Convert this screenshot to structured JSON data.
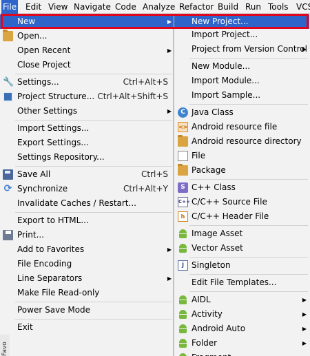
{
  "menubar": {
    "items": [
      "File",
      "Edit",
      "View",
      "Navigate",
      "Code",
      "Analyze",
      "Refactor",
      "Build",
      "Run",
      "Tools",
      "VCS"
    ],
    "active_item": "File"
  },
  "file_menu": {
    "new": "New",
    "open": "Open...",
    "open_recent": "Open Recent",
    "close_project": "Close Project",
    "settings": "Settings...",
    "settings_shortcut": "Ctrl+Alt+S",
    "project_structure": "Project Structure...",
    "project_structure_shortcut": "Ctrl+Alt+Shift+S",
    "other_settings": "Other Settings",
    "import_settings": "Import Settings...",
    "export_settings": "Export Settings...",
    "settings_repository": "Settings Repository...",
    "save_all": "Save All",
    "save_all_shortcut": "Ctrl+S",
    "synchronize": "Synchronize",
    "synchronize_shortcut": "Ctrl+Alt+Y",
    "invalidate_caches": "Invalidate Caches / Restart...",
    "export_html": "Export to HTML...",
    "print": "Print...",
    "add_to_favorites": "Add to Favorites",
    "file_encoding": "File Encoding",
    "line_separators": "Line Separators",
    "make_read_only": "Make File Read-only",
    "power_save_mode": "Power Save Mode",
    "exit": "Exit"
  },
  "new_submenu": {
    "new_project": "New Project...",
    "import_project": "Import Project...",
    "project_from_vcs": "Project from Version Control",
    "new_module": "New Module...",
    "import_module": "Import Module...",
    "import_sample": "Import Sample...",
    "java_class": "Java Class",
    "android_resource_file": "Android resource file",
    "android_resource_directory": "Android resource directory",
    "file": "File",
    "package": "Package",
    "cpp_class": "C++ Class",
    "cpp_source_file": "C/C++ Source File",
    "cpp_header_file": "C/C++ Header File",
    "image_asset": "Image Asset",
    "vector_asset": "Vector Asset",
    "singleton": "Singleton",
    "edit_file_templates": "Edit File Templates...",
    "aidl": "AIDL",
    "activity": "Activity",
    "android_auto": "Android Auto",
    "folder": "Folder",
    "fragment_partial": "Fragment"
  },
  "side_tab": "Favo",
  "colors": {
    "selection": "#2f65ca",
    "highlight_frame": "#e1061e",
    "menu_background": "#f2f2f2"
  }
}
